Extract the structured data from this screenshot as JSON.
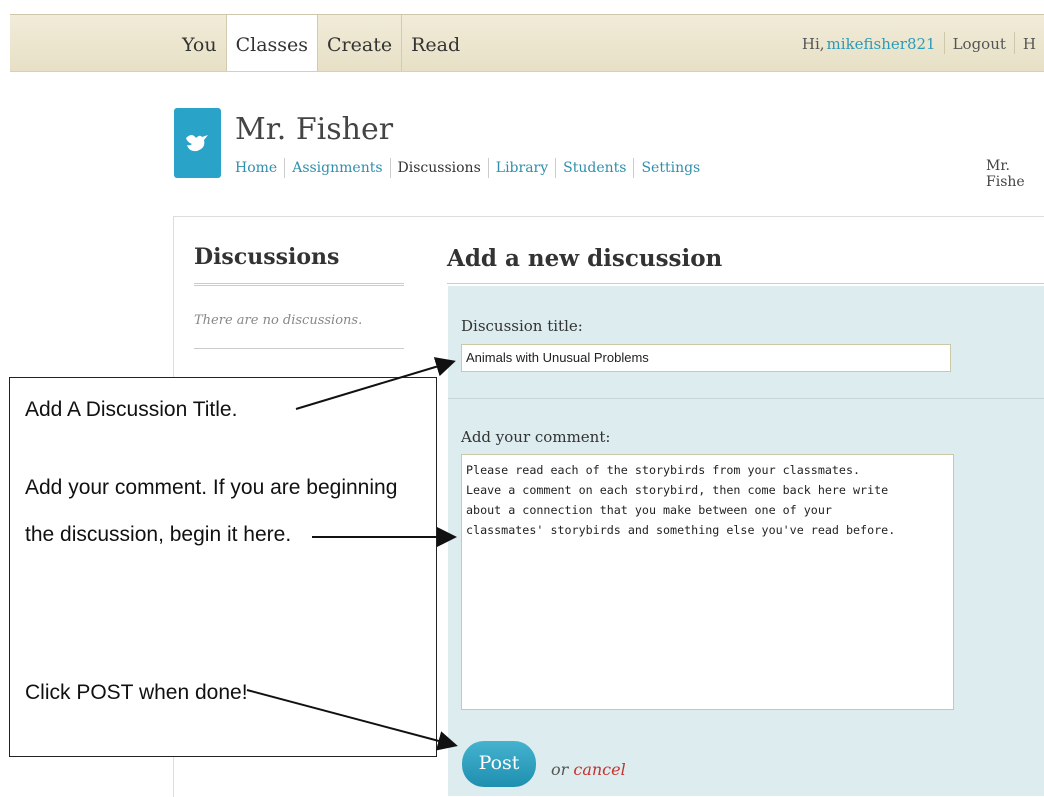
{
  "topnav": {
    "items": [
      "You",
      "Classes",
      "Create",
      "Read"
    ],
    "active": "Classes",
    "greeting": "Hi,",
    "username": "mikefisher821",
    "logout": "Logout",
    "help": "H"
  },
  "class": {
    "title": "Mr. Fisher",
    "nav": [
      "Home",
      "Assignments",
      "Discussions",
      "Library",
      "Students",
      "Settings"
    ],
    "current": "Discussions",
    "teacher_right": "Mr. Fishe"
  },
  "sidebar": {
    "title": "Discussions",
    "empty_text": "There are no discussions."
  },
  "form": {
    "heading": "Add a new discussion",
    "title_label": "Discussion title:",
    "title_value": "Animals with Unusual Problems",
    "comment_label": "Add your comment:",
    "comment_value": "Please read each of the storybirds from your classmates.\nLeave a comment on each storybird, then come back here write\nabout a connection that you make between one of your\nclassmates' storybirds and something else you've read before.",
    "post_label": "Post",
    "or_text": "or",
    "cancel_label": "cancel"
  },
  "callout": {
    "step1": "Add A Discussion Title.",
    "step2_line1": "Add your comment. If you are beginning",
    "step2_line2": "the discussion, begin it here.",
    "step3": "Click POST when done!"
  },
  "colors": {
    "accent": "#29a3c8",
    "panel": "#dcecef",
    "topbar": "#ece6cf",
    "cancel": "#c9302c"
  }
}
